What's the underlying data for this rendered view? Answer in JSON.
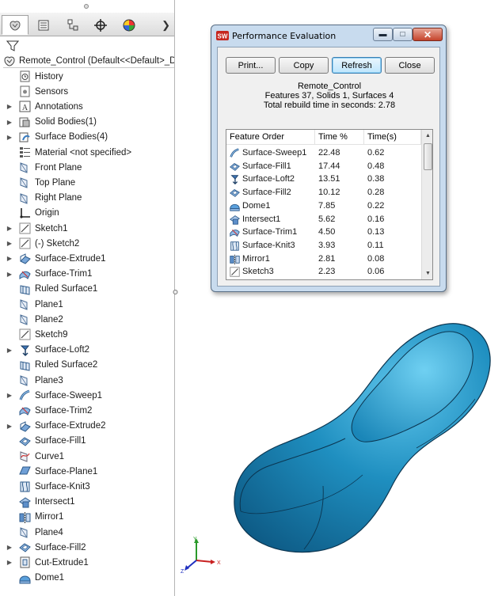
{
  "feature_manager": {
    "root": {
      "label": "Remote_Control  (Default<<Default>_Disp",
      "icon": "part-icon"
    },
    "tree": [
      {
        "label": "History",
        "icon": "history-icon",
        "expandable": false
      },
      {
        "label": "Sensors",
        "icon": "sensors-icon",
        "expandable": false
      },
      {
        "label": "Annotations",
        "icon": "annotations-icon",
        "expandable": true
      },
      {
        "label": "Solid Bodies(1)",
        "icon": "solid-bodies-icon",
        "expandable": true
      },
      {
        "label": "Surface Bodies(4)",
        "icon": "surface-bodies-icon",
        "expandable": true
      },
      {
        "label": "Material <not specified>",
        "icon": "material-icon",
        "expandable": false
      },
      {
        "label": "Front Plane",
        "icon": "plane-icon",
        "expandable": false
      },
      {
        "label": "Top Plane",
        "icon": "plane-icon",
        "expandable": false
      },
      {
        "label": "Right Plane",
        "icon": "plane-icon",
        "expandable": false
      },
      {
        "label": "Origin",
        "icon": "origin-icon",
        "expandable": false
      },
      {
        "label": "Sketch1",
        "icon": "sketch-icon",
        "expandable": true
      },
      {
        "label": "(-) Sketch2",
        "icon": "sketch-icon",
        "expandable": true
      },
      {
        "label": "Surface-Extrude1",
        "icon": "surface-extrude-icon",
        "expandable": true
      },
      {
        "label": "Surface-Trim1",
        "icon": "surface-trim-icon",
        "expandable": true
      },
      {
        "label": "Ruled Surface1",
        "icon": "ruled-surface-icon",
        "expandable": false
      },
      {
        "label": "Plane1",
        "icon": "plane-icon",
        "expandable": false
      },
      {
        "label": "Plane2",
        "icon": "plane-icon",
        "expandable": false
      },
      {
        "label": "Sketch9",
        "icon": "sketch-icon",
        "expandable": false
      },
      {
        "label": "Surface-Loft2",
        "icon": "surface-loft-icon",
        "expandable": true
      },
      {
        "label": "Ruled Surface2",
        "icon": "ruled-surface-icon",
        "expandable": false
      },
      {
        "label": "Plane3",
        "icon": "plane-icon",
        "expandable": false
      },
      {
        "label": "Surface-Sweep1",
        "icon": "surface-sweep-icon",
        "expandable": true
      },
      {
        "label": "Surface-Trim2",
        "icon": "surface-trim-icon",
        "expandable": false
      },
      {
        "label": "Surface-Extrude2",
        "icon": "surface-extrude-icon",
        "expandable": true
      },
      {
        "label": "Surface-Fill1",
        "icon": "surface-fill-icon",
        "expandable": false
      },
      {
        "label": "Curve1",
        "icon": "curve-icon",
        "expandable": false
      },
      {
        "label": "Surface-Plane1",
        "icon": "surface-plane-icon",
        "expandable": false
      },
      {
        "label": "Surface-Knit3",
        "icon": "surface-knit-icon",
        "expandable": false
      },
      {
        "label": "Intersect1",
        "icon": "intersect-icon",
        "expandable": false
      },
      {
        "label": "Mirror1",
        "icon": "mirror-icon",
        "expandable": false
      },
      {
        "label": "Plane4",
        "icon": "plane-icon",
        "expandable": false
      },
      {
        "label": "Surface-Fill2",
        "icon": "surface-fill-icon",
        "expandable": true
      },
      {
        "label": "Cut-Extrude1",
        "icon": "cut-extrude-icon",
        "expandable": true
      },
      {
        "label": "Dome1",
        "icon": "dome-icon",
        "expandable": false
      }
    ]
  },
  "dialog": {
    "title": "Performance Evaluation",
    "buttons": {
      "print": "Print...",
      "copy": "Copy",
      "refresh": "Refresh",
      "close": "Close"
    },
    "model_name": "Remote_Control",
    "counts": "Features 37, Solids 1, Surfaces 4",
    "rebuild_time": "Total rebuild time in seconds: 2.78",
    "columns": {
      "feature": "Feature Order",
      "percent": "Time %",
      "time": "Time(s)"
    },
    "rows": [
      {
        "feature": "Surface-Sweep1",
        "percent": "22.48",
        "time": "0.62",
        "icon": "surface-sweep-icon"
      },
      {
        "feature": "Surface-Fill1",
        "percent": "17.44",
        "time": "0.48",
        "icon": "surface-fill-icon"
      },
      {
        "feature": "Surface-Loft2",
        "percent": "13.51",
        "time": "0.38",
        "icon": "surface-loft-icon"
      },
      {
        "feature": "Surface-Fill2",
        "percent": "10.12",
        "time": "0.28",
        "icon": "surface-fill-icon"
      },
      {
        "feature": "Dome1",
        "percent": "7.85",
        "time": "0.22",
        "icon": "dome-icon"
      },
      {
        "feature": "Intersect1",
        "percent": "5.62",
        "time": "0.16",
        "icon": "intersect-icon"
      },
      {
        "feature": "Surface-Trim1",
        "percent": "4.50",
        "time": "0.13",
        "icon": "surface-trim-icon"
      },
      {
        "feature": "Surface-Knit3",
        "percent": "3.93",
        "time": "0.11",
        "icon": "surface-knit-icon"
      },
      {
        "feature": "Mirror1",
        "percent": "2.81",
        "time": "0.08",
        "icon": "mirror-icon"
      },
      {
        "feature": "Sketch3",
        "percent": "2.23",
        "time": "0.06",
        "icon": "sketch-icon"
      }
    ]
  },
  "colors": {
    "model_fill": "#1f8fc0",
    "model_highlight": "#5cc3ea",
    "model_edge": "#0b3550",
    "dialog_frame": "#c8dbee"
  }
}
